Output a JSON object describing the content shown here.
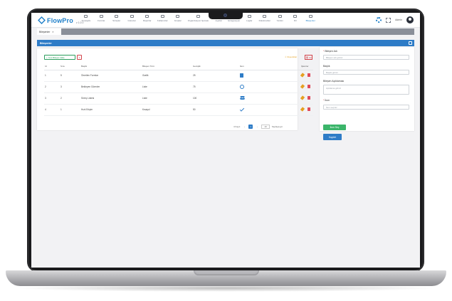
{
  "app": {
    "brand": "FlowPro",
    "version": "v 1.0.0",
    "user_name": "Admin"
  },
  "menu": [
    {
      "label": "Anasayfa",
      "icon": "home-icon"
    },
    {
      "label": "Formlar",
      "icon": "form-icon"
    },
    {
      "label": "Süreçler",
      "icon": "process-icon"
    },
    {
      "label": "Görevler",
      "icon": "task-icon"
    },
    {
      "label": "Raporlar",
      "icon": "report-icon"
    },
    {
      "label": "Kullanıcılar",
      "icon": "users-icon"
    },
    {
      "label": "Gruplar",
      "icon": "group-icon"
    },
    {
      "label": "Organizasyon Şeması",
      "icon": "org-icon"
    },
    {
      "label": "Ayarlar",
      "icon": "settings-icon"
    },
    {
      "label": "Entegrasyon",
      "icon": "integration-icon"
    },
    {
      "label": "Loglar",
      "icon": "log-icon"
    },
    {
      "label": "Dokümanlar",
      "icon": "document-icon"
    },
    {
      "label": "Yardım",
      "icon": "help-icon"
    },
    {
      "label": "Dil",
      "icon": "language-icon"
    },
    {
      "label": "Bileşenler",
      "icon": "component-icon"
    }
  ],
  "tab": {
    "label": "Bileşenler",
    "close": "×"
  },
  "card": {
    "title": "Bileşenler"
  },
  "toolbar": {
    "add_label": "+ Yeni Bileşen Ekle",
    "excel_label": "X",
    "export_label": "⇩ Dışa Aktar",
    "delete_label": "🗑 Sil"
  },
  "table": {
    "columns": [
      "Id",
      "Sıra",
      "Başlık",
      "Bileşen Türü",
      "Genişlik",
      "İkon",
      "İşlemler"
    ],
    "rows": [
      {
        "id": "1",
        "sira": "5",
        "baslik": "Önerilen Formlar",
        "tur": "Grafik",
        "genislik": "25",
        "icon": "doc-icon"
      },
      {
        "id": "2",
        "sira": "3",
        "baslik": "Bekleyen Görevler",
        "tur": "Liste",
        "genislik": "75",
        "icon": "globe-icon"
      },
      {
        "id": "3",
        "sira": "2",
        "baslik": "Süreç Listesi",
        "tur": "Liste",
        "genislik": "100",
        "icon": "users-icon"
      },
      {
        "id": "4",
        "sira": "1",
        "baslik": "Hızlı Erişim",
        "tur": "Kısayol",
        "genislik": "50",
        "icon": "check-icon"
      }
    ]
  },
  "pager": {
    "total": "4 Kayıt",
    "prev": "‹",
    "page": "1",
    "next": "›",
    "size": "10",
    "goto": "Sayfaya git"
  },
  "form": {
    "name_label": "Bileşen Adı",
    "name_placeholder": "Bileşen adı giriniz",
    "title_label": "Başlık",
    "title_placeholder": "Başlık giriniz",
    "desc_label": "Bileşen Açıklaması",
    "desc_placeholder": "Açıklama giriniz",
    "icon_label": "İkon",
    "icon_placeholder": "İkon seçiniz",
    "icon_button": "İkon Seç",
    "save_button": "Kaydet"
  }
}
